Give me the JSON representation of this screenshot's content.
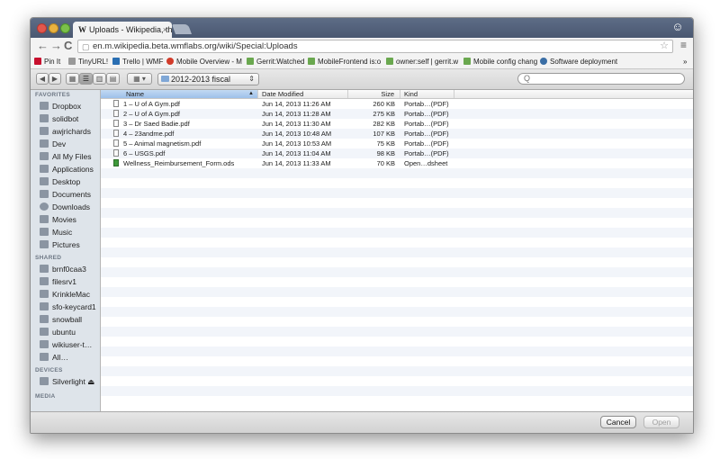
{
  "browser": {
    "tab_title": "Uploads - Wikipedia, the f",
    "tab_close": "×",
    "url": "en.m.wikipedia.beta.wmflabs.org/wiki/Special:Uploads",
    "bookmarks": [
      {
        "label": "Pin It",
        "color": "#c8102e"
      },
      {
        "label": "TinyURL!",
        "color": "#999999"
      },
      {
        "label": "Trello | WMF",
        "color": "#2a6fb3"
      },
      {
        "label": "Mobile Overview - M",
        "color": "#d23b2a"
      },
      {
        "label": "Gerrit:Watched",
        "color": "#6aa84f"
      },
      {
        "label": "MobileFrontend is:o",
        "color": "#6aa84f"
      },
      {
        "label": "owner:self | gerrit.w",
        "color": "#6aa84f"
      },
      {
        "label": "Mobile config chang",
        "color": "#6aa84f"
      },
      {
        "label": "Software deployment",
        "color": "#3a6ea5"
      }
    ],
    "bookmarks_more": "»"
  },
  "toolbar": {
    "folder": "2012-2013 fiscal",
    "search_placeholder": "Q"
  },
  "sidebar": {
    "favorites_head": "FAVORITES",
    "favorites": [
      "Dropbox",
      "solidbot",
      "awjrichards",
      "Dev",
      "All My Files",
      "Applications",
      "Desktop",
      "Documents",
      "Downloads",
      "Movies",
      "Music",
      "Pictures"
    ],
    "shared_head": "SHARED",
    "shared": [
      "brnf0caa3",
      "filesrv1",
      "KrinkleMac",
      "sfo-keycard1",
      "snowball",
      "ubuntu",
      "wikiuser-t…",
      "All…"
    ],
    "devices_head": "DEVICES",
    "devices": [
      "Silverlight ⏏"
    ],
    "media_head": "MEDIA"
  },
  "columns": {
    "name": "Name",
    "date": "Date Modified",
    "size": "Size",
    "kind": "Kind"
  },
  "files": [
    {
      "name": "1 – U of A Gym.pdf",
      "date": "Jun 14, 2013 11:26 AM",
      "size": "260 KB",
      "kind": "Portab…(PDF)",
      "type": "pdf"
    },
    {
      "name": "2 – U of A Gym.pdf",
      "date": "Jun 14, 2013 11:28 AM",
      "size": "275 KB",
      "kind": "Portab…(PDF)",
      "type": "pdf"
    },
    {
      "name": "3 – Dr Saed Badie.pdf",
      "date": "Jun 14, 2013 11:30 AM",
      "size": "282 KB",
      "kind": "Portab…(PDF)",
      "type": "pdf"
    },
    {
      "name": "4 – 23andme.pdf",
      "date": "Jun 14, 2013 10:48 AM",
      "size": "107 KB",
      "kind": "Portab…(PDF)",
      "type": "pdf"
    },
    {
      "name": "5 – Animal magnetism.pdf",
      "date": "Jun 14, 2013 10:53 AM",
      "size": "75 KB",
      "kind": "Portab…(PDF)",
      "type": "pdf"
    },
    {
      "name": "6 – USGS.pdf",
      "date": "Jun 14, 2013 11:04 AM",
      "size": "98 KB",
      "kind": "Portab…(PDF)",
      "type": "pdf"
    },
    {
      "name": "Wellness_Reimbursement_Form.ods",
      "date": "Jun 14, 2013 11:33 AM",
      "size": "70 KB",
      "kind": "Open…dsheet",
      "type": "sheet"
    }
  ],
  "buttons": {
    "cancel": "Cancel",
    "open": "Open"
  }
}
